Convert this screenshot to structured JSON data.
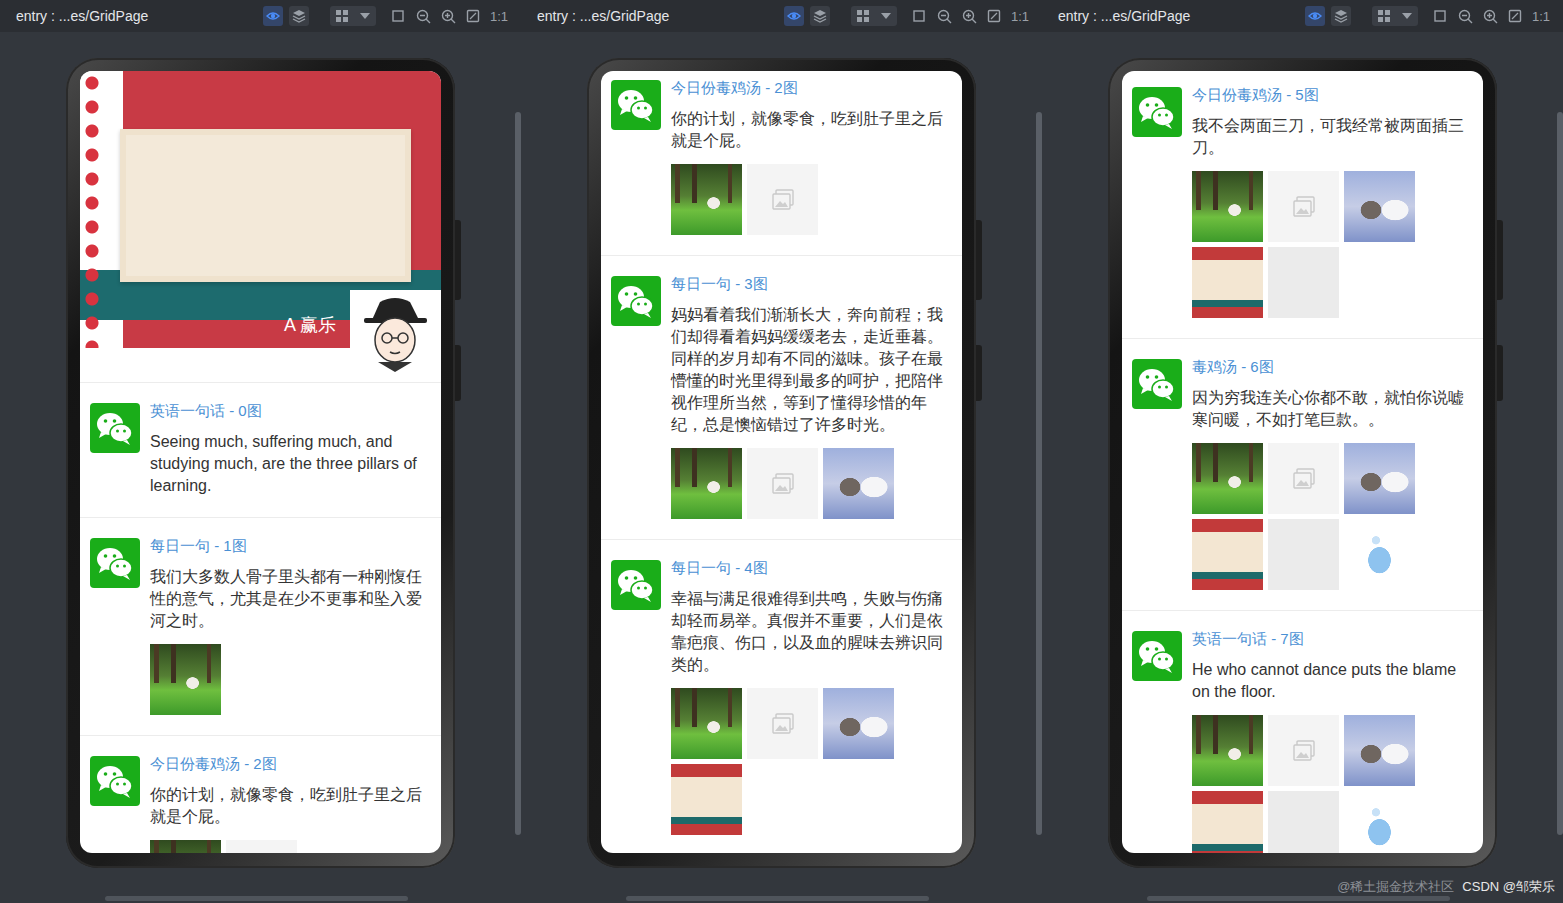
{
  "toolbar": {
    "title": "entry : ...es/GridPage",
    "zoom": "1:1"
  },
  "previews": [
    {
      "header": {
        "name": "A 赢乐"
      },
      "posts": [
        {
          "title": "英语一句话 - 0图",
          "text": "Seeing much, suffering much, and studying much, are the three pillars of learning.",
          "images": []
        },
        {
          "title": "每日一句 - 1图",
          "text": "我们大多数人骨子里头都有一种刚愎任性的意气，尤其是在少不更事和坠入爱河之时。",
          "images": [
            {
              "kind": "forest"
            }
          ]
        },
        {
          "title": "今日份毒鸡汤 - 2图",
          "text": "你的计划，就像零食，吃到肚子里之后就是个屁。",
          "images": [
            {
              "kind": "forest"
            },
            {
              "kind": "placeholder"
            }
          ]
        }
      ]
    },
    {
      "posts": [
        {
          "title": "今日份毒鸡汤 - 2图",
          "text": "你的计划，就像零食，吃到肚子里之后就是个屁。",
          "images": [
            {
              "kind": "forest"
            },
            {
              "kind": "placeholder"
            }
          ]
        },
        {
          "title": "每日一句 - 3图",
          "text": "妈妈看着我们渐渐长大，奔向前程；我们却得看着妈妈缓缓老去，走近垂暮。同样的岁月却有不同的滋味。孩子在最懵懂的时光里得到最多的呵护，把陪伴视作理所当然，等到了懂得珍惜的年纪，总是懊恼错过了许多时光。",
          "images": [
            {
              "kind": "forest"
            },
            {
              "kind": "placeholder"
            },
            {
              "kind": "cat"
            }
          ]
        },
        {
          "title": "每日一句 - 4图",
          "text": "幸福与满足很难得到共鸣，失败与伤痛却轻而易举。真假并不重要，人们是依靠疤痕、伤口，以及血的腥味去辨识同类的。",
          "images": [
            {
              "kind": "forest"
            },
            {
              "kind": "placeholder"
            },
            {
              "kind": "cat"
            },
            {
              "kind": "christmas"
            }
          ]
        }
      ]
    },
    {
      "posts": [
        {
          "title": "今日份毒鸡汤 - 5图",
          "text": "我不会两面三刀，可我经常被两面插三刀。",
          "images": [
            {
              "kind": "forest"
            },
            {
              "kind": "placeholder"
            },
            {
              "kind": "cat"
            },
            {
              "kind": "christmas"
            },
            {
              "kind": "weui"
            }
          ]
        },
        {
          "title": "毒鸡汤 - 6图",
          "text": "因为穷我连关心你都不敢，就怕你说嘘寒问暖，不如打笔巨款。。",
          "images": [
            {
              "kind": "forest"
            },
            {
              "kind": "placeholder"
            },
            {
              "kind": "cat"
            },
            {
              "kind": "christmas"
            },
            {
              "kind": "weui"
            },
            {
              "kind": "box"
            }
          ]
        },
        {
          "title": "英语一句话 - 7图",
          "text": "He who cannot dance puts the blame on the floor.",
          "images": [
            {
              "kind": "forest"
            },
            {
              "kind": "placeholder"
            },
            {
              "kind": "cat"
            },
            {
              "kind": "christmas"
            },
            {
              "kind": "weui"
            },
            {
              "kind": "box"
            }
          ]
        }
      ]
    }
  ],
  "watermark": [
    "@稀土掘金技术社区",
    "CSDN @邹荣乐"
  ]
}
